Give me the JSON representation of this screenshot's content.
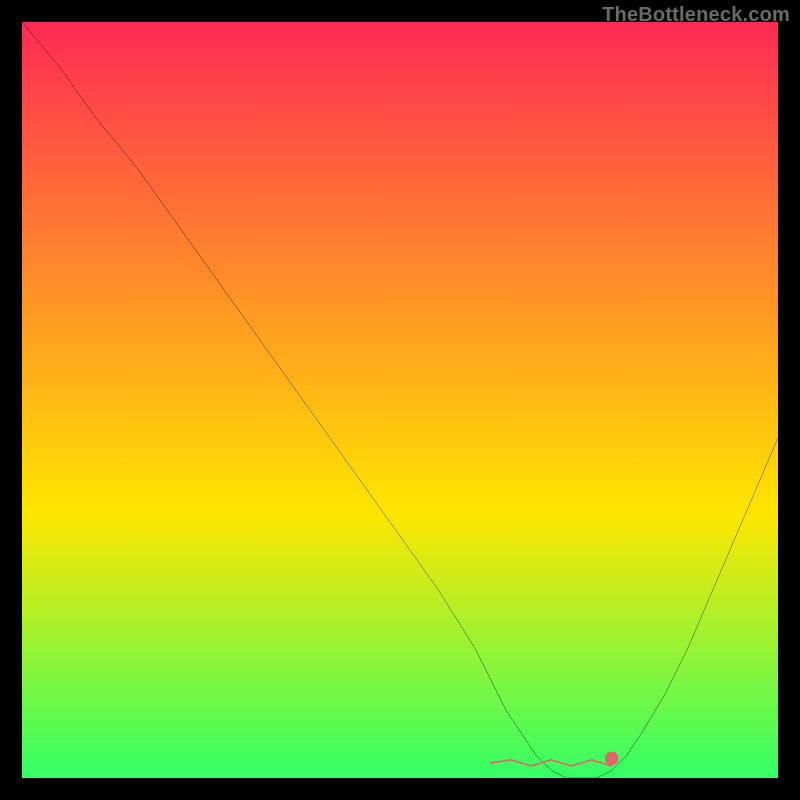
{
  "attribution": "TheBottleneck.com",
  "chart_data": {
    "type": "line",
    "title": "",
    "xlabel": "",
    "ylabel": "",
    "xlim": [
      0,
      100
    ],
    "ylim": [
      0,
      100
    ],
    "background_gradient": {
      "top": "#ff2a55",
      "mid": "#ffe600",
      "bottom": "#33ff66"
    },
    "series": [
      {
        "name": "bottleneck-curve",
        "x": [
          0,
          5,
          10,
          15,
          20,
          25,
          30,
          35,
          40,
          45,
          50,
          55,
          60,
          62,
          64,
          66,
          68,
          70,
          72,
          74,
          76,
          78,
          80,
          82,
          85,
          88,
          91,
          94,
          97,
          100
        ],
        "values": [
          100,
          94,
          87,
          81,
          74,
          67,
          60,
          53,
          46,
          39,
          32,
          25,
          17,
          13,
          9,
          6,
          3,
          1,
          0,
          0,
          0,
          1,
          3,
          6,
          11,
          17,
          24,
          31,
          38,
          45
        ]
      }
    ],
    "annotations": {
      "flat_zone": {
        "x_start": 62,
        "x_end": 78,
        "y": 2,
        "color": "#e06666"
      }
    }
  }
}
